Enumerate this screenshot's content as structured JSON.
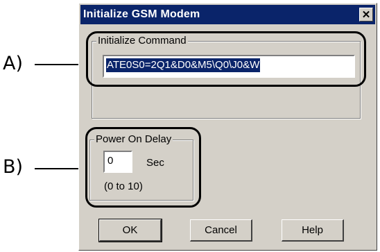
{
  "dialog": {
    "title": "Initialize GSM Modem",
    "close_glyph": "✕"
  },
  "init_group": {
    "label": "Initialize Command",
    "value": "ATE0S0=2Q1&D0&M5\\Q0\\J0&W"
  },
  "delay_group": {
    "label": "Power On Delay",
    "value": "0",
    "unit": "Sec",
    "range": "(0 to 10)"
  },
  "buttons": {
    "ok": "OK",
    "cancel": "Cancel",
    "help": "Help"
  },
  "callouts": {
    "a": "A)",
    "b": "B)"
  }
}
